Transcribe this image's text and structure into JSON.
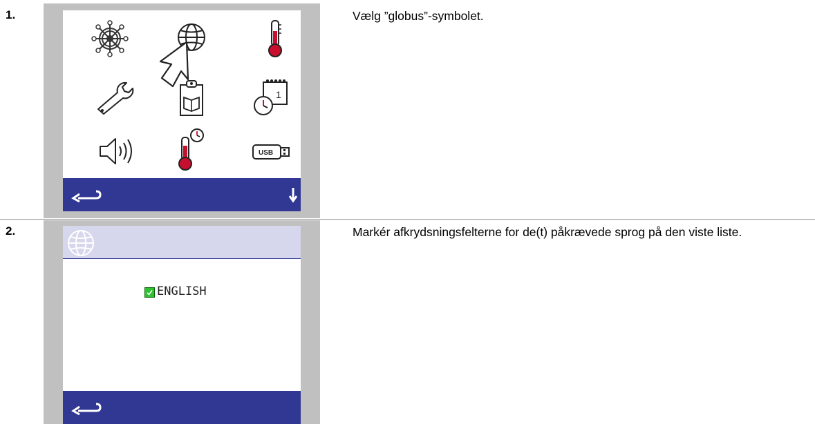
{
  "steps": [
    {
      "number": "1.",
      "instruction": "Vælg ”globus”-symbolet.",
      "screen": {
        "icons": [
          "wheel-icon",
          "globe-icon",
          "thermometer-icon",
          "wrench-icon",
          "manual-icon",
          "calendar-clock-icon",
          "speaker-icon",
          "thermometer-clock-icon",
          "usb-icon"
        ],
        "bar": [
          "back-arrow-icon",
          "down-arrow-icon"
        ],
        "pointer": "pointer-arrow-icon"
      }
    },
    {
      "number": "2.",
      "instruction": "Markér afkrydsningsfelterne for de(t) påkrævede sprog på den viste liste.",
      "screen": {
        "header_icon": "globe-icon",
        "language": "ENGLISH",
        "language_checked": true,
        "bar": [
          "back-arrow-icon"
        ]
      }
    }
  ],
  "colors": {
    "bar": "#313894",
    "frame": "#c0c0c0",
    "header": "#d6d6ec",
    "checkbox": "#2ec22e",
    "thermo_red": "#c8102e"
  }
}
